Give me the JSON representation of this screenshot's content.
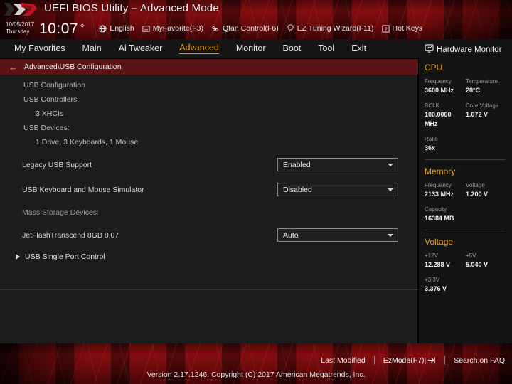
{
  "header": {
    "title": "UEFI BIOS Utility – Advanced Mode",
    "logo_icon": "rog-logo-icon",
    "date": "10/05/2017",
    "weekday": "Thursday",
    "time": "10:07",
    "gear_icon": "gear-icon",
    "quick_items": [
      {
        "label": "English",
        "icon": "globe-icon"
      },
      {
        "label": "MyFavorite(F3)",
        "icon": "list-icon"
      },
      {
        "label": "Qfan Control(F6)",
        "icon": "fan-icon"
      },
      {
        "label": "EZ Tuning Wizard(F11)",
        "icon": "bulb-icon"
      },
      {
        "label": "Hot Keys",
        "icon": "question-box-icon"
      }
    ]
  },
  "menu": {
    "tabs": [
      {
        "label": "My Favorites",
        "active": false
      },
      {
        "label": "Main",
        "active": false
      },
      {
        "label": "Ai Tweaker",
        "active": false
      },
      {
        "label": "Advanced",
        "active": true
      },
      {
        "label": "Monitor",
        "active": false
      },
      {
        "label": "Boot",
        "active": false
      },
      {
        "label": "Tool",
        "active": false
      },
      {
        "label": "Exit",
        "active": false
      }
    ],
    "active_color": "#e8a317"
  },
  "breadcrumb": {
    "back_icon": "back-arrow-icon",
    "path": "Advanced\\USB Configuration"
  },
  "content": {
    "section_title": "USB Configuration",
    "controllers_label": "USB Controllers:",
    "controllers_value": "3 XHCIs",
    "devices_label": "USB Devices:",
    "devices_value": "1 Drive, 3 Keyboards, 1 Mouse",
    "settings": [
      {
        "label": "Legacy USB Support",
        "value": "Enabled"
      },
      {
        "label": "USB Keyboard and Mouse Simulator",
        "value": "Disabled"
      }
    ],
    "mass_storage_label": "Mass Storage Devices:",
    "mass_storage_device": {
      "label": "JetFlashTranscend 8GB 8.07",
      "value": "Auto"
    },
    "subpage": {
      "label": "USB Single Port Control",
      "arrow_icon": "right-arrow-icon"
    },
    "info_icon": "info-icon"
  },
  "hardware_monitor": {
    "title": "Hardware Monitor",
    "title_icon": "monitor-icon",
    "sections": [
      {
        "name": "CPU",
        "rows": [
          [
            {
              "key": "Frequency",
              "value": "3600 MHz"
            },
            {
              "key": "Temperature",
              "value": "28°C"
            }
          ],
          [
            {
              "key": "BCLK",
              "value": "100.0000 MHz"
            },
            {
              "key": "Core Voltage",
              "value": "1.072 V"
            }
          ],
          [
            {
              "key": "Ratio",
              "value": "36x"
            }
          ]
        ]
      },
      {
        "name": "Memory",
        "rows": [
          [
            {
              "key": "Frequency",
              "value": "2133 MHz"
            },
            {
              "key": "Voltage",
              "value": "1.200 V"
            }
          ],
          [
            {
              "key": "Capacity",
              "value": "16384 MB"
            }
          ]
        ]
      },
      {
        "name": "Voltage",
        "rows": [
          [
            {
              "key": "+12V",
              "value": "12.288 V"
            },
            {
              "key": "+5V",
              "value": "5.040 V"
            }
          ],
          [
            {
              "key": "+3.3V",
              "value": "3.376 V"
            }
          ]
        ]
      }
    ]
  },
  "footer": {
    "links": [
      {
        "label": "Last Modified",
        "icon": ""
      },
      {
        "label": "EzMode(F7)|",
        "icon": "exit-arrow-icon"
      },
      {
        "label": "Search on FAQ",
        "icon": ""
      }
    ],
    "version": "Version 2.17.1246. Copyright (C) 2017 American Megatrends, Inc."
  }
}
